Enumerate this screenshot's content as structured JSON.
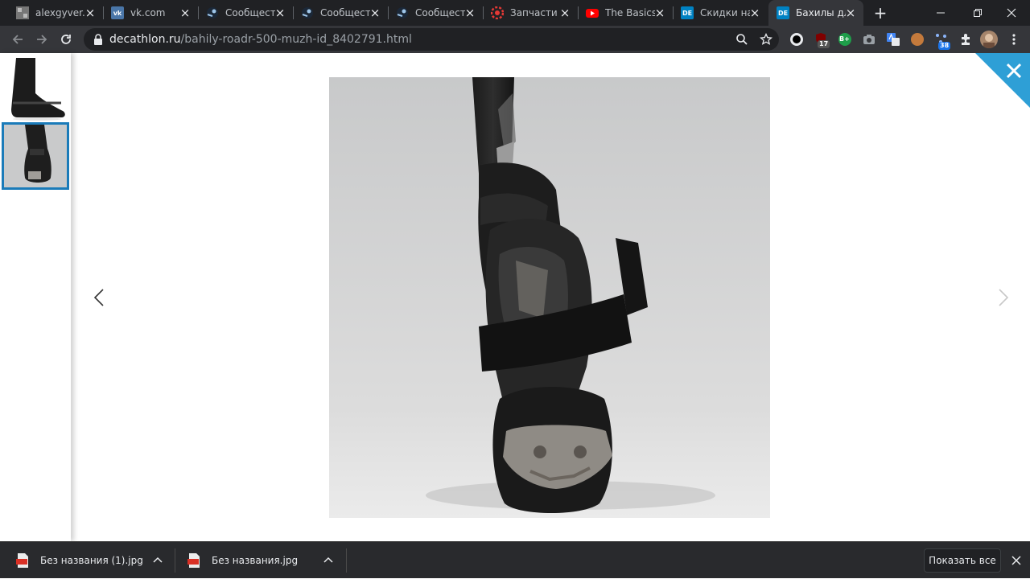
{
  "tabs": [
    {
      "title": "alexgyver.ru",
      "icon": "alexgyver-icon",
      "active": false
    },
    {
      "title": "vk.com",
      "icon": "vk-icon",
      "active": false
    },
    {
      "title": "Сообщество",
      "icon": "steam-icon",
      "active": false
    },
    {
      "title": "Сообщество",
      "icon": "steam-icon",
      "active": false
    },
    {
      "title": "Сообщество",
      "icon": "steam-icon",
      "active": false
    },
    {
      "title": "Запчасти д",
      "icon": "parts-icon",
      "active": false
    },
    {
      "title": "The Basics c",
      "icon": "youtube-icon",
      "active": false
    },
    {
      "title": "Скидки на",
      "icon": "decathlon-icon",
      "active": false
    },
    {
      "title": "Бахилы для",
      "icon": "decathlon-icon",
      "active": true
    }
  ],
  "favicon_text": {
    "decathlon": "DE",
    "vk": "vk"
  },
  "address_bar": {
    "domain": "decathlon.ru",
    "path": "/bahily-roadr-500-muzh-id_8402791.html"
  },
  "extensions": {
    "ublock_badge": "17",
    "tabs_badge": "38",
    "green_ext_label": "B+"
  },
  "downloads": [
    {
      "name": "Без названия (1).jpg",
      "type": "JPG"
    },
    {
      "name": "Без названия.jpg",
      "type": "JPG"
    }
  ],
  "downloads_show_all": "Показать все",
  "colors": {
    "accent": "#1a7bb9",
    "corner_close": "#2e9fd6",
    "frame": "#202124",
    "toolbar": "#35363a"
  }
}
